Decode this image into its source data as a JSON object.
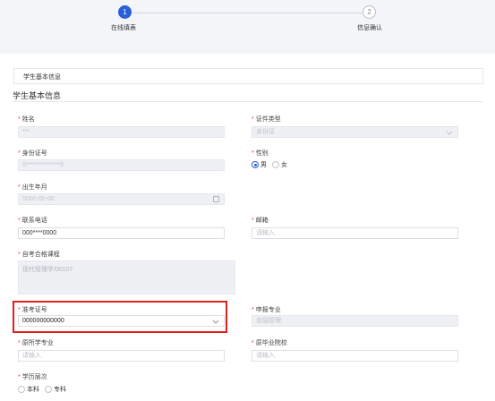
{
  "steps": [
    {
      "number": "1",
      "label": "在线填表",
      "state": "active"
    },
    {
      "number": "2",
      "label": "信息确认",
      "state": "inactive"
    }
  ],
  "section_box_title": "学生基本信息",
  "section_title": "学生基本信息",
  "fields": {
    "name": {
      "label": "姓名",
      "value": "***"
    },
    "id_type": {
      "label": "证件类型",
      "value": "身份证"
    },
    "id_number": {
      "label": "身份证号",
      "value": "0**************9"
    },
    "gender": {
      "label": "性别",
      "options": [
        "男",
        "女"
      ],
      "selected": "男"
    },
    "birth": {
      "label": "出生年月",
      "value": "0000-00-00"
    },
    "phone": {
      "label": "联系电话",
      "value": "000****0000"
    },
    "email": {
      "label": "邮箱",
      "placeholder": "请输入"
    },
    "course": {
      "label": "自考合格课程",
      "value": "现代管理学/00107"
    },
    "exam_id": {
      "label": "准考证号",
      "value": "000000000000"
    },
    "apply_major": {
      "label": "申报专业",
      "value": "金融管理"
    },
    "orig_major": {
      "label": "原所学专业",
      "placeholder": "请输入"
    },
    "orig_school": {
      "label": "原毕业院校",
      "placeholder": "请输入"
    },
    "edu_level": {
      "label": "学历层次",
      "options": [
        "本科",
        "专科"
      ],
      "selected": ""
    }
  },
  "colors": {
    "accent": "#2b5fd9",
    "required": "#e4393c",
    "highlight": "#e02020"
  }
}
